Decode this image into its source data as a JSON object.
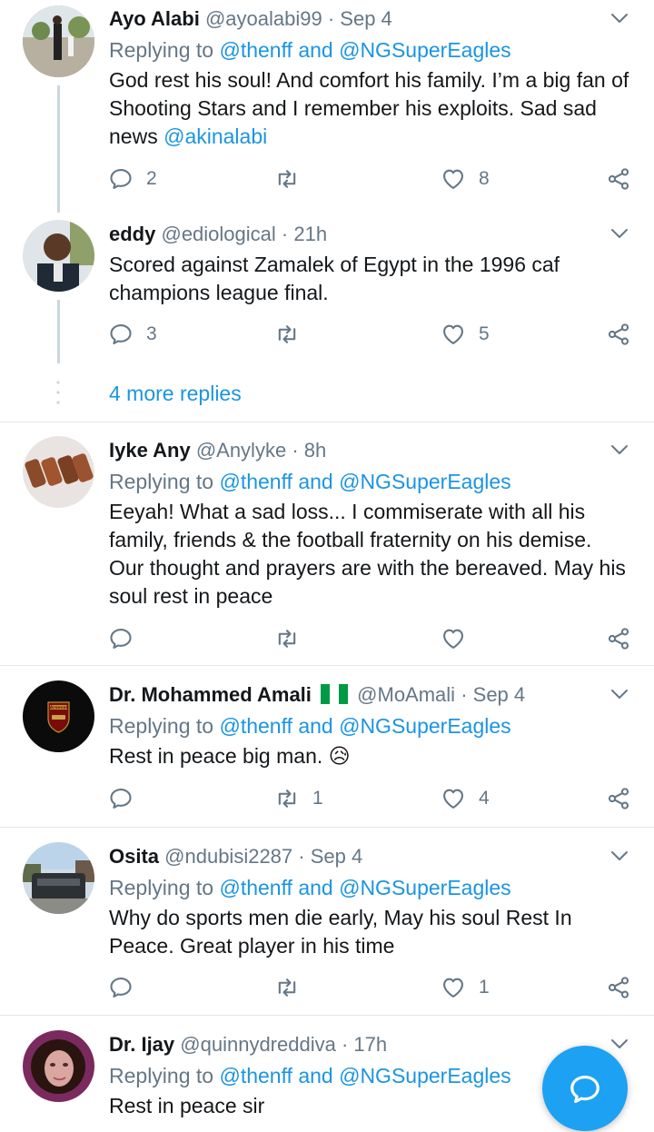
{
  "colors": {
    "link": "#1b95e0",
    "muted": "#657786",
    "fab": "#1da1f2",
    "divider": "#e1e8ed"
  },
  "tweets": [
    {
      "name": "Ayo Alabi",
      "handle": "@ayoalabi99",
      "dot": "·",
      "time": "Sep 4",
      "replying_prefix": "Replying to ",
      "replying_mentions": "@thenff and @NGSuperEagles",
      "text": "God rest his soul! And comfort his family. I’m a big fan of Shooting Stars and I remember his exploits. Sad sad news ",
      "text_mention": "@akinalabi",
      "replies": "2",
      "retweets": "",
      "likes": "8"
    },
    {
      "name": "eddy",
      "handle": "@ediological",
      "dot": "·",
      "time": "21h",
      "text": "Scored against Zamalek of Egypt in the 1996 caf champions league final.",
      "replies": "3",
      "retweets": "",
      "likes": "5"
    },
    {
      "name": "Iyke Any",
      "handle": "@Anylyke",
      "dot": "·",
      "time": "8h",
      "replying_prefix": "Replying to ",
      "replying_mentions": "@thenff and @NGSuperEagles",
      "text": "Eeyah! What a sad loss... I commiserate with all his family, friends & the football fraternity on his demise. Our thought and prayers are with the bereaved. May his soul rest in peace",
      "replies": "",
      "retweets": "",
      "likes": ""
    },
    {
      "name": "Dr. Mohammed Amali",
      "flag": "nigeria-flag",
      "handle": "@MoAmali",
      "dot": "·",
      "time": "Sep 4",
      "replying_prefix": "Replying to ",
      "replying_mentions": "@thenff and @NGSuperEagles",
      "text": "Rest in peace big man.",
      "emoji": "😥",
      "replies": "",
      "retweets": "1",
      "likes": "4",
      "avatar_label": "Arsenal"
    },
    {
      "name": "Osita",
      "handle": "@ndubisi2287",
      "dot": "·",
      "time": "Sep 4",
      "replying_prefix": "Replying to ",
      "replying_mentions": "@thenff and @NGSuperEagles",
      "text": "Why do sports men die early, May his soul Rest In Peace. Great player in his time",
      "replies": "",
      "retweets": "",
      "likes": "1"
    },
    {
      "name": "Dr. Ijay",
      "handle": "@quinnydreddiva",
      "dot": "·",
      "time": "17h",
      "replying_prefix": "Replying to ",
      "replying_mentions": "@thenff and @NGSuperEagles",
      "text": "Rest in peace sir"
    }
  ],
  "more_replies": "4 more replies",
  "icons": {
    "reply": "reply-icon",
    "retweet": "retweet-icon",
    "like": "like-icon",
    "share": "share-icon",
    "menu": "chevron-down-icon",
    "compose": "compose-reply-icon"
  }
}
